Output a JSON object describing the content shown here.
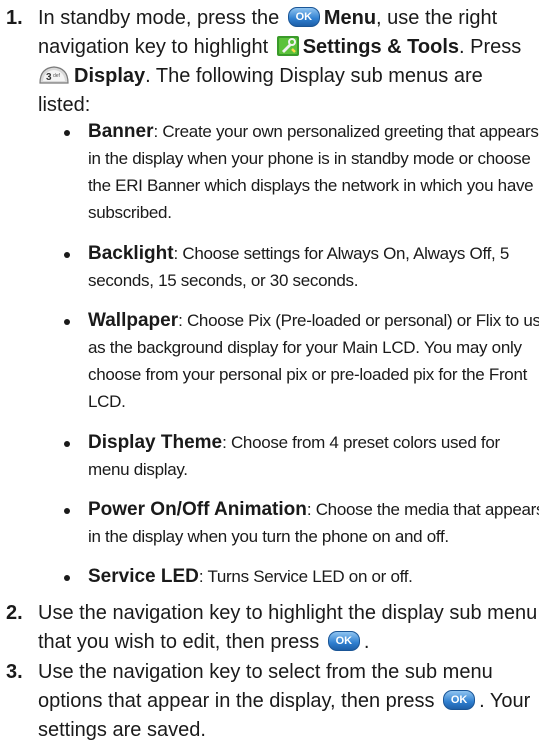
{
  "steps": [
    {
      "num": "1.",
      "l1_pre": "In standby mode, press the",
      "l1_menu": "Menu",
      "l1_post": ", use the right",
      "l2_pre": "navigation key to highlight",
      "l2_settings": "Settings & Tools",
      "l2_post": ". Press",
      "l3_display": "Display",
      "l3_post": ". The following Display sub menus are",
      "l4": "listed:"
    },
    {
      "num": "2.",
      "l1": "Use the navigation key to highlight the display sub menu",
      "l2_pre": "that you wish to edit, then press",
      "l2_post": "."
    },
    {
      "num": "3.",
      "l1": "Use the navigation key to select from the sub menu",
      "l2_pre": "options that appear in the display, then press",
      "l2_post": ". Your",
      "l3": "settings are saved."
    }
  ],
  "bullets": [
    {
      "title": "Banner",
      "lines": [
        ": Create your own personalized greeting that appears",
        "in the display when your phone is in standby mode or choose",
        "the ERI Banner which displays the network in which you have",
        "subscribed."
      ]
    },
    {
      "title": "Backlight",
      "lines": [
        ": Choose settings for Always On, Always Off, 5",
        "seconds, 15 seconds, or 30 seconds."
      ]
    },
    {
      "title": "Wallpaper",
      "lines": [
        ": Choose Pix (Pre-loaded or personal) or Flix to use",
        "as the background display for your Main LCD. You may only",
        "choose from your personal pix or pre-loaded pix for the Front",
        "LCD."
      ]
    },
    {
      "title": "Display Theme",
      "lines": [
        ": Choose from 4 preset colors used for",
        "menu display."
      ]
    },
    {
      "title": "Power On/Off Animation",
      "lines": [
        ": Choose the media that appears",
        "in the display when you turn the phone on and off."
      ]
    },
    {
      "title": "Service LED",
      "lines": [
        ": Turns Service LED on or off."
      ]
    }
  ],
  "icons": {
    "ok_key_label": "OK",
    "key3_label": "3"
  }
}
